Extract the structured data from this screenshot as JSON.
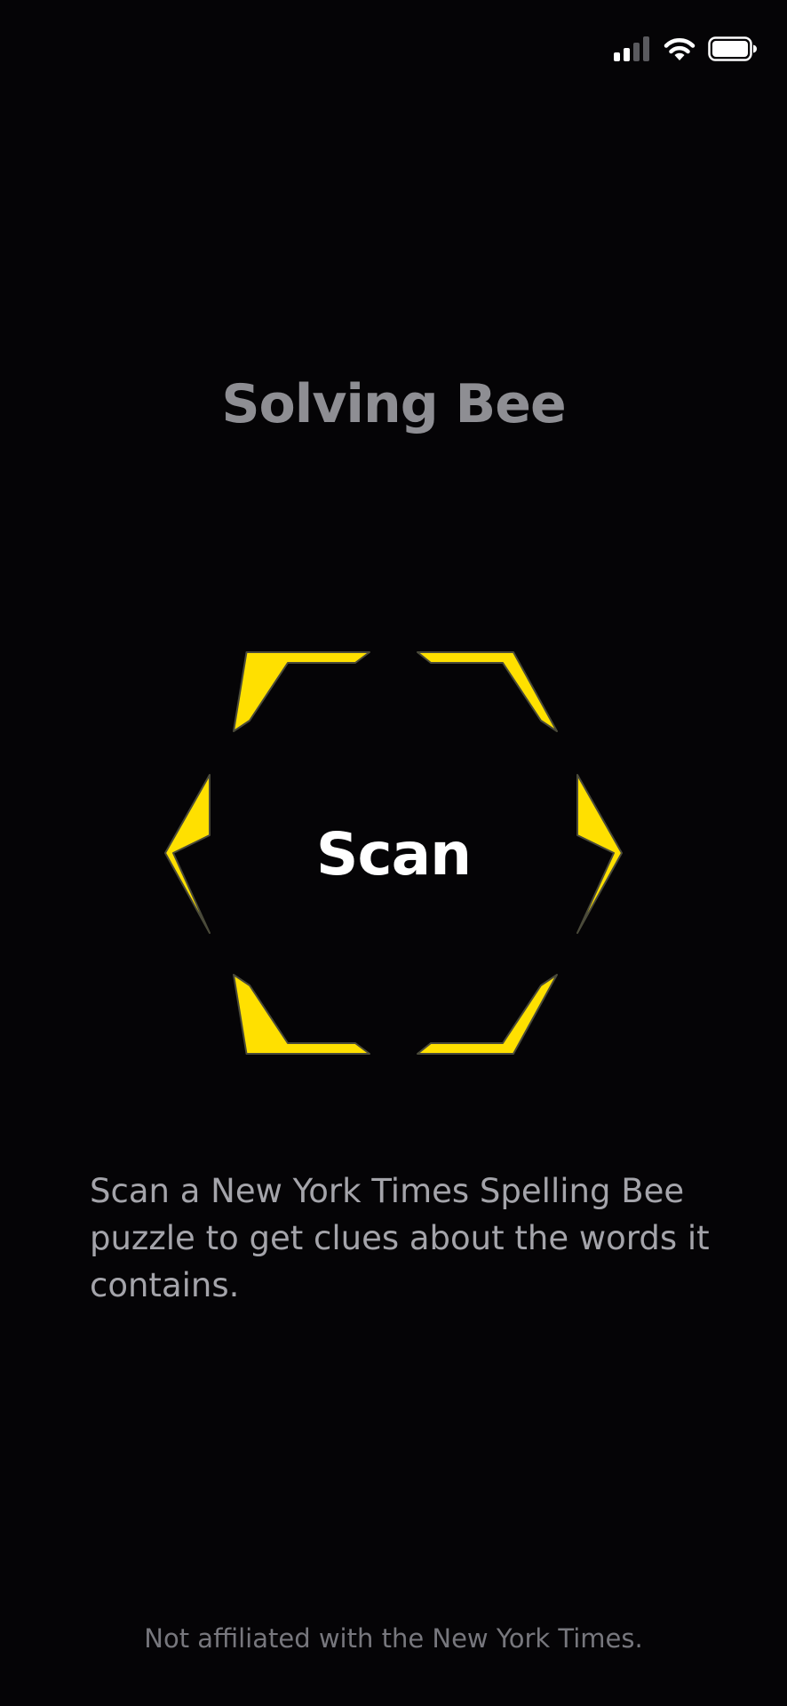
{
  "app": {
    "title": "Solving Bee"
  },
  "status_bar": {
    "icons": [
      "cellular-signal-icon",
      "wifi-icon",
      "battery-icon"
    ]
  },
  "scan_button": {
    "label": "Scan",
    "accent_color": "#ffe000",
    "outline_color": "#4a4a3a"
  },
  "description": "Scan a New York Times Spelling Bee puzzle to get clues about the words it contains.",
  "disclaimer": "Not affiliated with the New York Times.",
  "colors": {
    "background": "#050406",
    "title": "#8e8e93",
    "body_text": "#a4a4aa",
    "footer_text": "#77777d"
  }
}
